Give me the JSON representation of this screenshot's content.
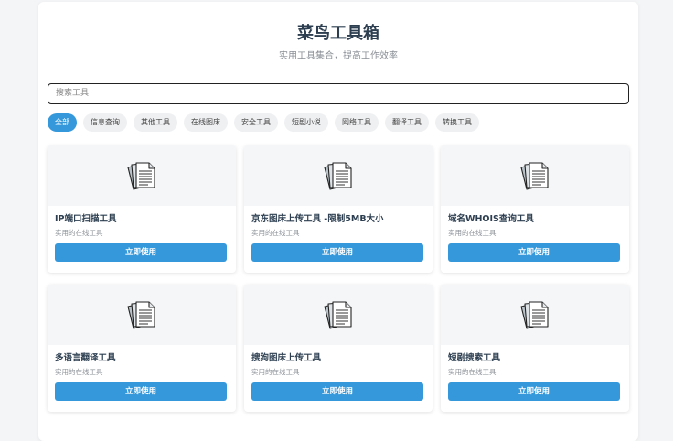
{
  "header": {
    "title": "菜鸟工具箱",
    "subtitle": "实用工具集合，提高工作效率"
  },
  "search": {
    "placeholder": "搜索工具"
  },
  "tags": [
    {
      "label": "全部",
      "active": true
    },
    {
      "label": "信息查询"
    },
    {
      "label": "其他工具"
    },
    {
      "label": "在线图床"
    },
    {
      "label": "安全工具"
    },
    {
      "label": "短剧小说"
    },
    {
      "label": "网络工具"
    },
    {
      "label": "翻译工具"
    },
    {
      "label": "转换工具"
    }
  ],
  "cards": [
    {
      "title": "IP端口扫描工具",
      "desc": "实用的在线工具",
      "button": "立即使用",
      "icon": "documents-icon"
    },
    {
      "title": "京东图床上传工具 -限制5MB大小",
      "desc": "实用的在线工具",
      "button": "立即使用",
      "icon": "documents-icon"
    },
    {
      "title": "域名WHOIS查询工具",
      "desc": "实用的在线工具",
      "button": "立即使用",
      "icon": "documents-icon"
    },
    {
      "title": "多语言翻译工具",
      "desc": "实用的在线工具",
      "button": "立即使用",
      "icon": "documents-icon"
    },
    {
      "title": "搜狗图床上传工具",
      "desc": "实用的在线工具",
      "button": "立即使用",
      "icon": "documents-icon"
    },
    {
      "title": "短剧搜索工具",
      "desc": "实用的在线工具",
      "button": "立即使用",
      "icon": "documents-icon"
    }
  ],
  "colors": {
    "accent": "#3498db",
    "title": "#2c3e50"
  }
}
